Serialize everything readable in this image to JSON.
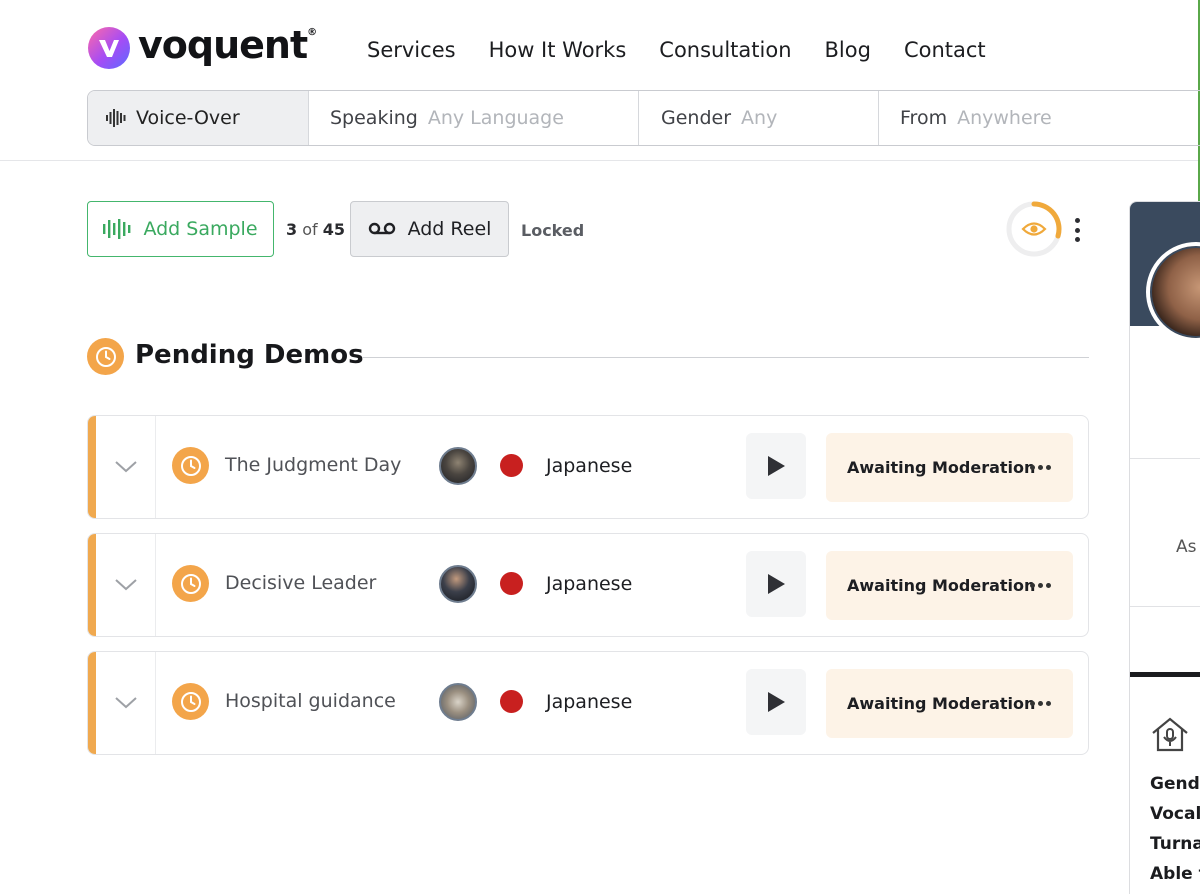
{
  "brand": {
    "name": "voquent",
    "registered": "®"
  },
  "nav": {
    "items": [
      {
        "label": "Services"
      },
      {
        "label": "How It Works"
      },
      {
        "label": "Consultation"
      },
      {
        "label": "Blog"
      },
      {
        "label": "Contact"
      }
    ]
  },
  "search": {
    "type": {
      "label": "Voice-Over",
      "icon": "waveform-icon"
    },
    "language": {
      "label": "Speaking",
      "value": "Any Language"
    },
    "gender": {
      "label": "Gender",
      "value": "Any"
    },
    "from": {
      "label": "From",
      "value": "Anywhere"
    }
  },
  "toolbar": {
    "add_sample": "Add Sample",
    "count_current": "3",
    "count_of": "of",
    "count_total": "45",
    "add_reel": "Add Reel",
    "locked": "Locked",
    "visibility_icon": "eye-icon",
    "accent_color": "#3aa95f",
    "ring_color": "#f0a93b"
  },
  "section": {
    "title": "Pending Demos",
    "icon": "clock-icon",
    "color": "#f3a54a"
  },
  "demos": [
    {
      "title": "The Judgment Day",
      "language": "Japanese",
      "status": "Awaiting Moderation"
    },
    {
      "title": "Decisive Leader",
      "language": "Japanese",
      "status": "Awaiting Moderation"
    },
    {
      "title": "Hospital guidance",
      "language": "Japanese",
      "status": "Awaiting Moderation"
    }
  ],
  "profile_card": {
    "partial_text": "As",
    "attributes": [
      "Gend",
      "Vocal",
      "Turna",
      "Able t"
    ]
  }
}
